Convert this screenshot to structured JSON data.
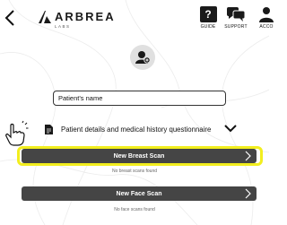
{
  "header": {
    "logo_text": "ARBREA",
    "logo_sub": "LABS",
    "nav": [
      {
        "label": "GUIDE",
        "icon": "question-icon"
      },
      {
        "label": "SUPPORT",
        "icon": "chat-icon"
      },
      {
        "label": "ACCO",
        "icon": "account-icon"
      }
    ]
  },
  "patient": {
    "name_placeholder": "Patient's name",
    "questionnaire_label": "Patient details and medical history questionnaire"
  },
  "scans": [
    {
      "label": "New Breast Scan",
      "status": "No breast scans found"
    },
    {
      "label": "New Face Scan",
      "status": "No face scans found"
    }
  ],
  "colors": {
    "highlight": "#f2ee1e",
    "button": "#454545",
    "avatar_bg": "#e0e0e0"
  }
}
